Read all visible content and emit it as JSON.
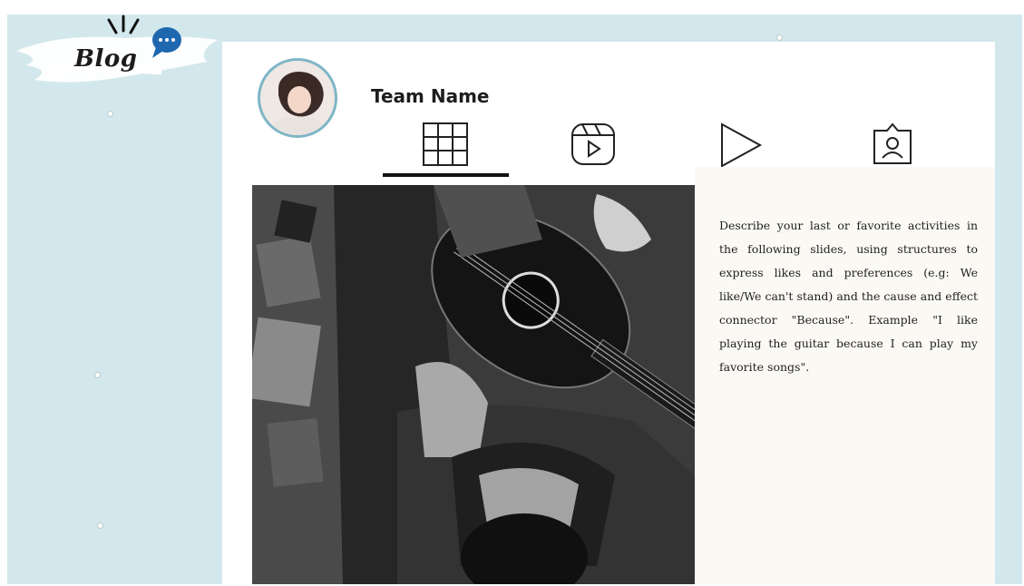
{
  "logo": {
    "text": "Blog",
    "bubble_icon": "speech-bubble-icon"
  },
  "profile": {
    "team_name": "Team Name",
    "avatar": "avatar-photo"
  },
  "tabs": [
    {
      "icon": "grid-icon",
      "active": true
    },
    {
      "icon": "reels-icon",
      "active": false
    },
    {
      "icon": "play-icon",
      "active": false
    },
    {
      "icon": "tagged-user-icon",
      "active": false
    }
  ],
  "post": {
    "photo": "guitar-player-photo",
    "description": "Describe your last or favorite activities in the following slides, using structures to express likes and preferences (e.g: We like/We can't stand) and the cause and effect connector \"Because\". Example \"I like playing the guitar because I can play my favorite songs\"."
  },
  "colors": {
    "background": "#d3e8ec",
    "card": "#ffffff",
    "text_panel": "#fbf9f4",
    "avatar_ring": "#7fb6c6",
    "bubble": "#1f68b0"
  }
}
